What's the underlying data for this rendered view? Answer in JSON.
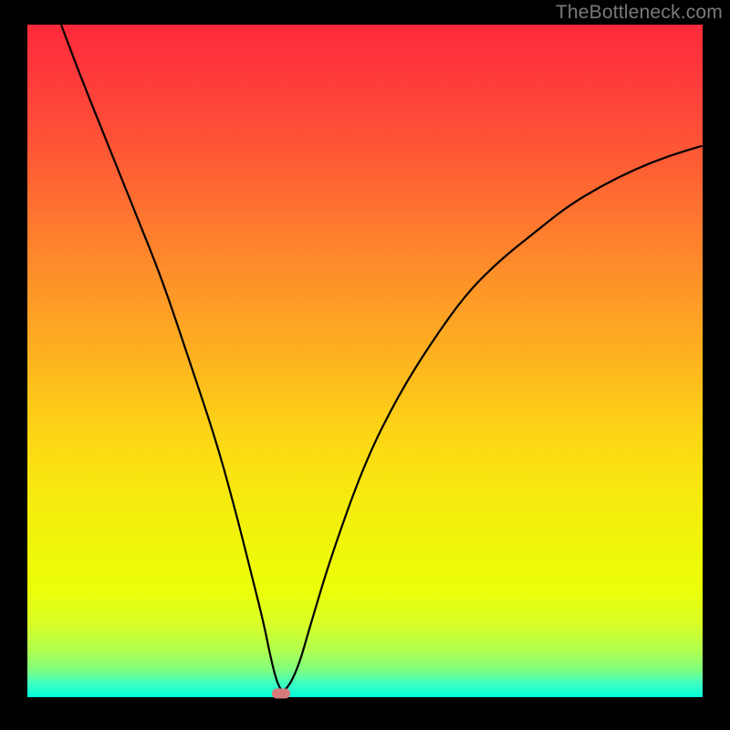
{
  "watermark": "TheBottleneck.com",
  "chart_data": {
    "type": "line",
    "title": "",
    "xlabel": "",
    "ylabel": "",
    "xlim": [
      0,
      100
    ],
    "ylim": [
      0,
      100
    ],
    "grid": false,
    "series": [
      {
        "name": "bottleneck-curve",
        "x": [
          5,
          8,
          12,
          16,
          20,
          24,
          28,
          31,
          33,
          35,
          36,
          37,
          38,
          40,
          42,
          45,
          50,
          55,
          60,
          65,
          70,
          75,
          80,
          85,
          90,
          95,
          100
        ],
        "y": [
          100,
          92,
          82,
          72,
          62,
          50,
          38,
          27,
          19,
          11,
          6,
          2,
          0.5,
          4,
          11,
          21,
          35,
          45,
          53,
          60,
          65,
          69,
          73,
          76,
          78.5,
          80.5,
          82
        ]
      }
    ],
    "minimum_marker": {
      "x": 37.5,
      "y": 0.5
    },
    "gradient_colors": {
      "top": "#fe2a3b",
      "middle": "#fdd316",
      "bottom": "#00ffdd"
    }
  }
}
